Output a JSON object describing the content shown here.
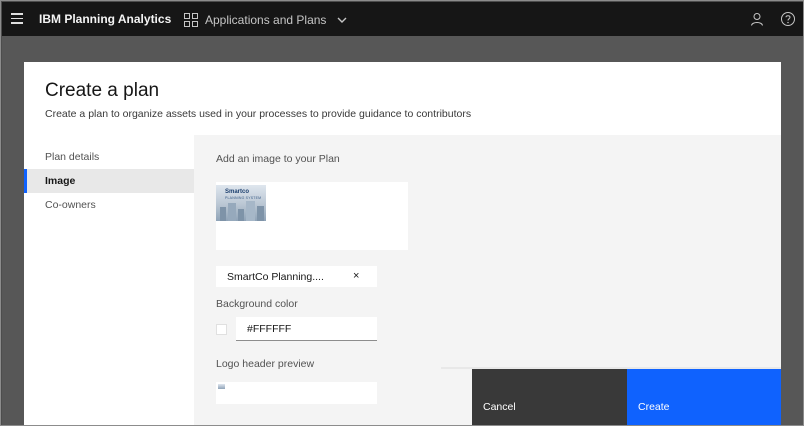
{
  "topbar": {
    "brand": "IBM Planning Analytics",
    "app_switcher_label": "Applications and Plans",
    "icons": [
      "menu-icon",
      "apps-icon",
      "chevron-down-icon",
      "user-icon",
      "help-icon"
    ]
  },
  "modal": {
    "title": "Create a plan",
    "subtitle": "Create a plan to organize assets used in your processes to provide guidance to contributors"
  },
  "side_nav": {
    "items": [
      {
        "label": "Plan details",
        "active": false
      },
      {
        "label": "Image",
        "active": true
      },
      {
        "label": "Co-owners",
        "active": false
      }
    ]
  },
  "image_section": {
    "add_image_label": "Add an image to your Plan",
    "thumbnail_title": "Smartco",
    "thumbnail_subtitle": "PLANNING SYSTEM",
    "file_name": "SmartCo Planning....",
    "remove_glyph": "×"
  },
  "background": {
    "label": "Background color",
    "value": "#FFFFFF"
  },
  "logo": {
    "label": "Logo header preview"
  },
  "footer": {
    "cancel_label": "Cancel",
    "create_label": "Create"
  },
  "colors": {
    "accent": "#0f62fe",
    "topbar": "#161616",
    "cancel_bg": "#393939"
  }
}
